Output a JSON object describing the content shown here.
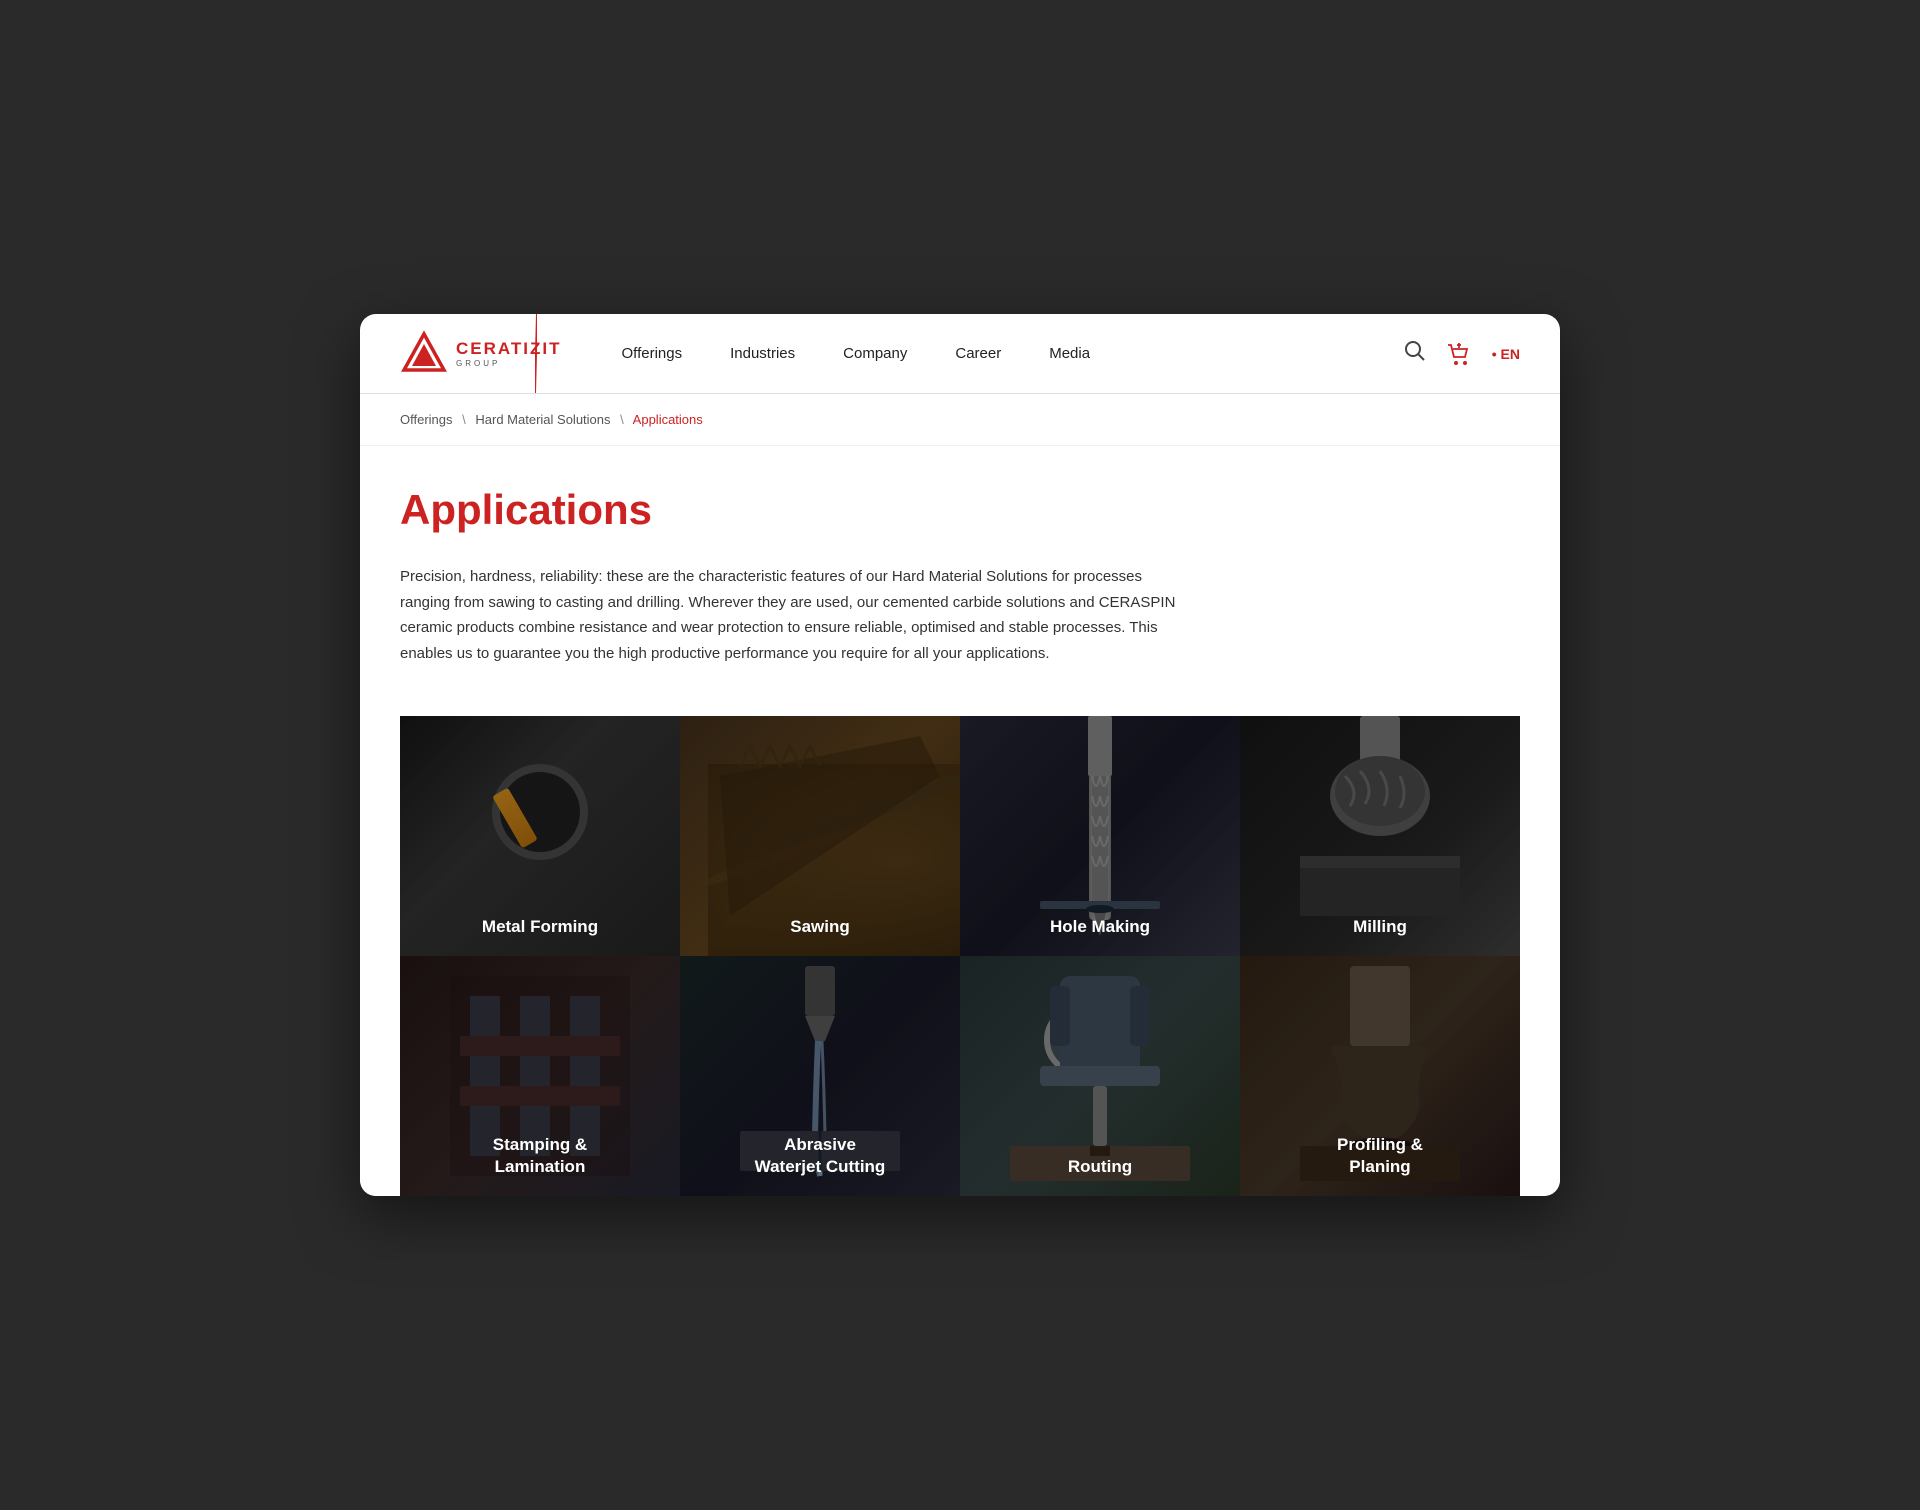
{
  "browser": {
    "background": "#2a2a2a"
  },
  "header": {
    "logo_ceratizit": "CERATIZIT",
    "logo_group": "GROUP",
    "nav_items": [
      {
        "label": "Offerings",
        "id": "offerings"
      },
      {
        "label": "Industries",
        "id": "industries"
      },
      {
        "label": "Company",
        "id": "company"
      },
      {
        "label": "Career",
        "id": "career"
      },
      {
        "label": "Media",
        "id": "media"
      }
    ],
    "language": "• EN"
  },
  "breadcrumb": {
    "items": [
      {
        "label": "Offerings",
        "id": "offerings"
      },
      {
        "label": "Hard Material Solutions",
        "id": "hard-material"
      },
      {
        "label": "Applications",
        "id": "applications",
        "current": true
      }
    ]
  },
  "main": {
    "page_title": "Applications",
    "description": "Precision, hardness, reliability: these are the characteristic features of our Hard Material Solutions for processes ranging from sawing to casting and drilling. Wherever they are used, our cemented carbide solutions and CERASPIN ceramic products combine resistance and wear protection to ensure reliable, optimised and stable processes. This enables us to guarantee you the high productive performance you require for all your applications."
  },
  "cards": {
    "row1": [
      {
        "label": "Metal Forming",
        "id": "metal-forming",
        "class": "card-metal-forming"
      },
      {
        "label": "Sawing",
        "id": "sawing",
        "class": "card-sawing"
      },
      {
        "label": "Hole Making",
        "id": "hole-making",
        "class": "card-hole-making"
      },
      {
        "label": "Milling",
        "id": "milling",
        "class": "card-milling"
      }
    ],
    "row2": [
      {
        "label": "Stamping &\nLamination",
        "id": "stamping",
        "class": "card-stamping",
        "multiline": "Stamping &<br>Lamination"
      },
      {
        "label": "Abrasive\nWaterjet Cutting",
        "id": "abrasive",
        "class": "card-abrasive",
        "multiline": "Abrasive<br>Waterjet Cutting"
      },
      {
        "label": "Routing",
        "id": "routing",
        "class": "card-routing"
      },
      {
        "label": "Profiling &\nPlaning",
        "id": "profiling",
        "class": "card-profiling",
        "multiline": "Profiling &<br>Planing"
      }
    ]
  },
  "colors": {
    "brand_red": "#cc2222",
    "text_dark": "#222",
    "text_mid": "#555"
  }
}
